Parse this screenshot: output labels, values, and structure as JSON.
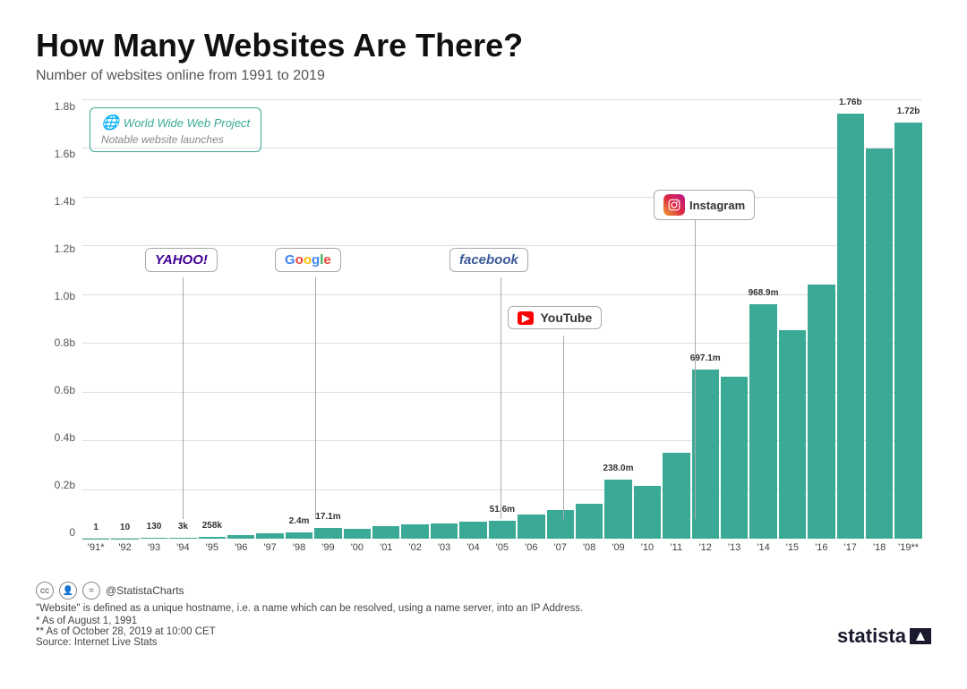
{
  "title": "How Many Websites Are There?",
  "subtitle": "Number of websites online from 1991 to 2019",
  "yLabels": [
    "0",
    "0.2b",
    "0.4b",
    "0.6b",
    "0.8b",
    "1.0b",
    "1.2b",
    "1.4b",
    "1.6b",
    "1.8b"
  ],
  "bars": [
    {
      "year": "'91*",
      "value": 1,
      "label": "1",
      "height": 0.001
    },
    {
      "year": "'92",
      "value": 10,
      "label": "10",
      "height": 0.001
    },
    {
      "year": "'93",
      "value": 130,
      "label": "130",
      "height": 0.002
    },
    {
      "year": "'94",
      "value": 3000,
      "label": "3k",
      "height": 0.003
    },
    {
      "year": "'95",
      "value": 258000,
      "label": "258k",
      "height": 0.005
    },
    {
      "year": "'96",
      "value": 600000,
      "label": "",
      "height": 0.008
    },
    {
      "year": "'97",
      "value": 1000000,
      "label": "",
      "height": 0.012
    },
    {
      "year": "'98",
      "value": 2400000,
      "label": "2.4m",
      "height": 0.015
    },
    {
      "year": "'99",
      "value": 17100000,
      "label": "17.1m",
      "height": 0.025
    },
    {
      "year": "'00",
      "value": 17000000,
      "label": "",
      "height": 0.022
    },
    {
      "year": "'01",
      "value": 25000000,
      "label": "",
      "height": 0.028
    },
    {
      "year": "'02",
      "value": 38000000,
      "label": "",
      "height": 0.032
    },
    {
      "year": "'03",
      "value": 40000000,
      "label": "",
      "height": 0.034
    },
    {
      "year": "'04",
      "value": 51000000,
      "label": "",
      "height": 0.038
    },
    {
      "year": "'05",
      "value": 51600000,
      "label": "51.6m",
      "height": 0.04
    },
    {
      "year": "'06",
      "value": 95000000,
      "label": "",
      "height": 0.055
    },
    {
      "year": "'07",
      "value": 120000000,
      "label": "",
      "height": 0.065
    },
    {
      "year": "'08",
      "value": 172000000,
      "label": "",
      "height": 0.08
    },
    {
      "year": "'09",
      "value": 238000000,
      "label": "238.0m",
      "height": 0.135
    },
    {
      "year": "'10",
      "value": 210000000,
      "label": "",
      "height": 0.12
    },
    {
      "year": "'11",
      "value": 350000000,
      "label": "",
      "height": 0.195
    },
    {
      "year": "'12",
      "value": 697100000,
      "label": "697.1m",
      "height": 0.385
    },
    {
      "year": "'13",
      "value": 670000000,
      "label": "",
      "height": 0.37
    },
    {
      "year": "'14",
      "value": 968900000,
      "label": "968.9m",
      "height": 0.535
    },
    {
      "year": "'15",
      "value": 863000000,
      "label": "",
      "height": 0.475
    },
    {
      "year": "'16",
      "value": 1050000000,
      "label": "",
      "height": 0.58
    },
    {
      "year": "'17",
      "value": 1760000000,
      "label": "1.76b",
      "height": 0.97
    },
    {
      "year": "'18",
      "value": 1620000000,
      "label": "",
      "height": 0.89
    },
    {
      "year": "'19**",
      "value": 1720000000,
      "label": "1.72b",
      "height": 0.95
    }
  ],
  "annotations": {
    "wwwLabel": "World Wide Web Project",
    "notableLabel": "Notable website launches",
    "yahoo": "YAHOO!",
    "google": "Google",
    "facebook": "facebook",
    "youtube": "YouTube",
    "instagram": "Instagram"
  },
  "footer": {
    "definition": "\"Website\" is defined as a unique hostname, i.e. a name which can be resolved, using a name server, into an IP Address.",
    "note1": "* As of August 1, 1991",
    "note2": "** As of October 28, 2019 at 10:00 CET",
    "source": "Source: Internet Live Stats",
    "handle": "@StatistaCharts",
    "brand": "statista"
  }
}
